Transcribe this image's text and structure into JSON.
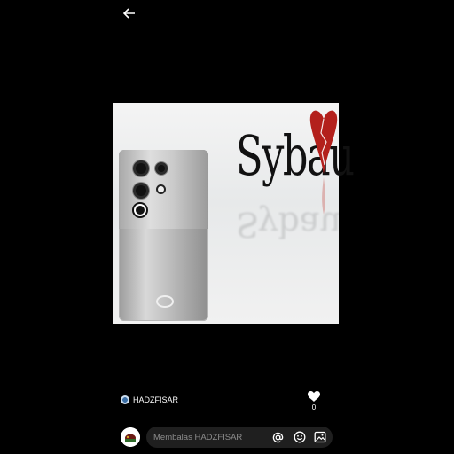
{
  "media": {
    "overlay_text": "Sybau"
  },
  "post": {
    "username": "HADZFISAR",
    "like_count": "0"
  },
  "reply": {
    "placeholder": "Membalas HADZFISAR"
  },
  "icons": {
    "back": "arrow-left-icon",
    "like": "heart-icon",
    "mention": "at-icon",
    "emoji": "smiley-icon",
    "image": "image-icon"
  },
  "colors": {
    "background": "#000000",
    "input_background": "#1f1f1f",
    "placeholder": "#8c8c8c",
    "heart_red": "#b3201c"
  }
}
